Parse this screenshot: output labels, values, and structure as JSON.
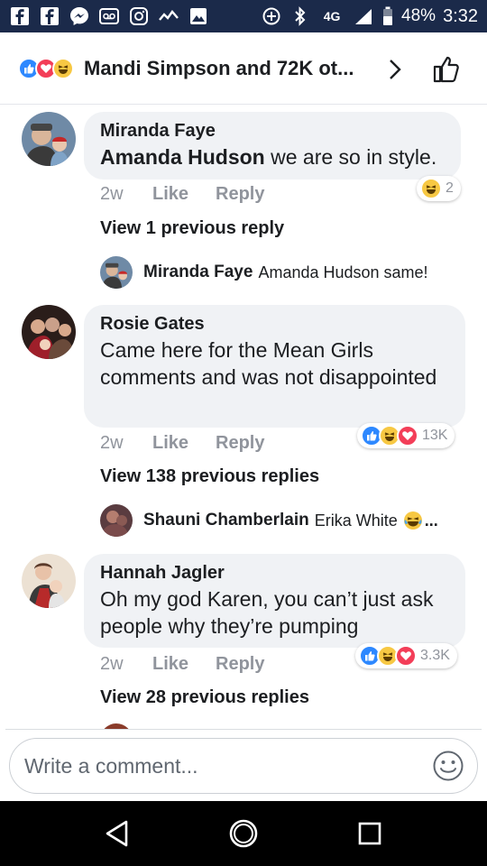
{
  "status_bar": {
    "battery": "48%",
    "time": "3:32",
    "network": "4G"
  },
  "header": {
    "title": "Mandi Simpson and 72K ot...",
    "reactions": [
      "like",
      "love",
      "haha"
    ]
  },
  "comments": [
    {
      "name": "Miranda Faye",
      "mention": "Amanda Hudson",
      "text": " we are so in style.",
      "time": "2w",
      "like_label": "Like",
      "reply_label": "Reply",
      "reaction_count": "2",
      "view_previous": "View 1 previous reply",
      "last_reply": {
        "name": "Miranda Faye",
        "text": "Amanda Hudson same!"
      }
    },
    {
      "name": "Rosie Gates",
      "text": "Came here for the Mean Girls comments and was not disappointed",
      "time": "2w",
      "like_label": "Like",
      "reply_label": "Reply",
      "reaction_count": "13K",
      "view_previous": "View 138 previous replies",
      "last_reply": {
        "name": "Shauni Chamberlain",
        "text": "Erika White"
      }
    },
    {
      "name": "Hannah Jagler",
      "text": "Oh my god Karen, you can’t just ask people why they’re pumping",
      "time": "2w",
      "like_label": "Like",
      "reply_label": "Reply",
      "reaction_count": "3.3K",
      "view_previous": "View 28 previous replies"
    }
  ],
  "composer": {
    "placeholder": "Write a comment..."
  },
  "colors": {
    "like": "#2d88ff",
    "love": "#f33e58",
    "haha": "#f7c843",
    "bubble": "#f0f2f5",
    "status_bar": "#1b2a4a"
  }
}
